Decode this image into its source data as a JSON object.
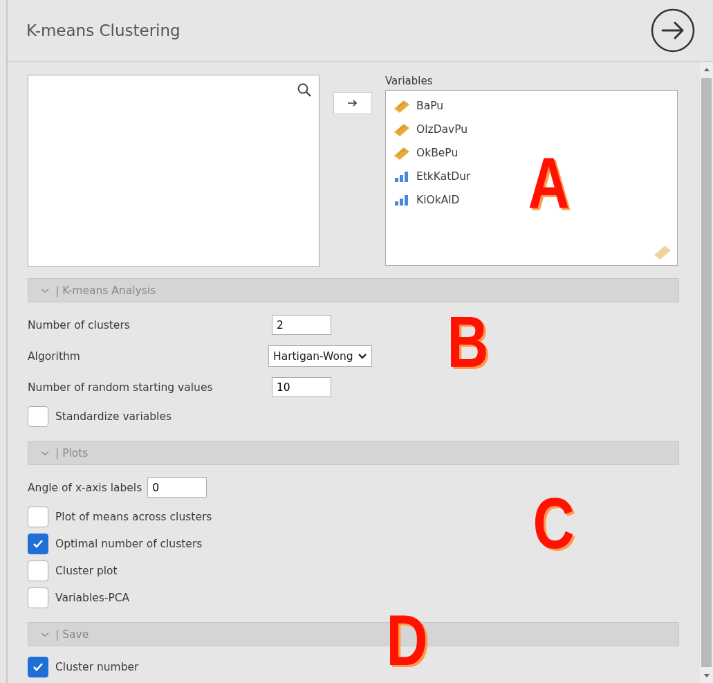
{
  "title": "K-means Clustering",
  "variables": {
    "label": "Variables",
    "items": [
      {
        "name": "BaPu",
        "kind": "continuous"
      },
      {
        "name": "OlzDavPu",
        "kind": "continuous"
      },
      {
        "name": "OkBePu",
        "kind": "continuous"
      },
      {
        "name": "EtkKatDur",
        "kind": "ordinal"
      },
      {
        "name": "KiOkAlD",
        "kind": "ordinal"
      }
    ]
  },
  "sections": [
    {
      "title": "| K-means Analysis",
      "expanded": true,
      "items": [
        {
          "kind": "number",
          "label": "Number of clusters",
          "value": "2"
        },
        {
          "kind": "select",
          "label": "Algorithm",
          "value": "Hartigan-Wong"
        },
        {
          "kind": "number",
          "label": "Number of random starting values",
          "value": "10"
        },
        {
          "kind": "checkbox",
          "label": "Standardize variables",
          "checked": false
        }
      ]
    },
    {
      "title": "| Plots",
      "expanded": true,
      "items": [
        {
          "kind": "number",
          "label": "Angle of x-axis labels",
          "value": "0"
        },
        {
          "kind": "checkbox",
          "label": "Plot of means across clusters",
          "checked": false
        },
        {
          "kind": "checkbox",
          "label": "Optimal number of clusters",
          "checked": true
        },
        {
          "kind": "checkbox",
          "label": "Cluster plot",
          "checked": false
        },
        {
          "kind": "checkbox",
          "label": "Variables-PCA",
          "checked": false
        }
      ]
    },
    {
      "title": "| Save",
      "expanded": true,
      "items": [
        {
          "kind": "checkbox",
          "label": "Cluster number",
          "checked": true
        }
      ]
    }
  ],
  "annotations": [
    "A",
    "B",
    "C",
    "D"
  ]
}
